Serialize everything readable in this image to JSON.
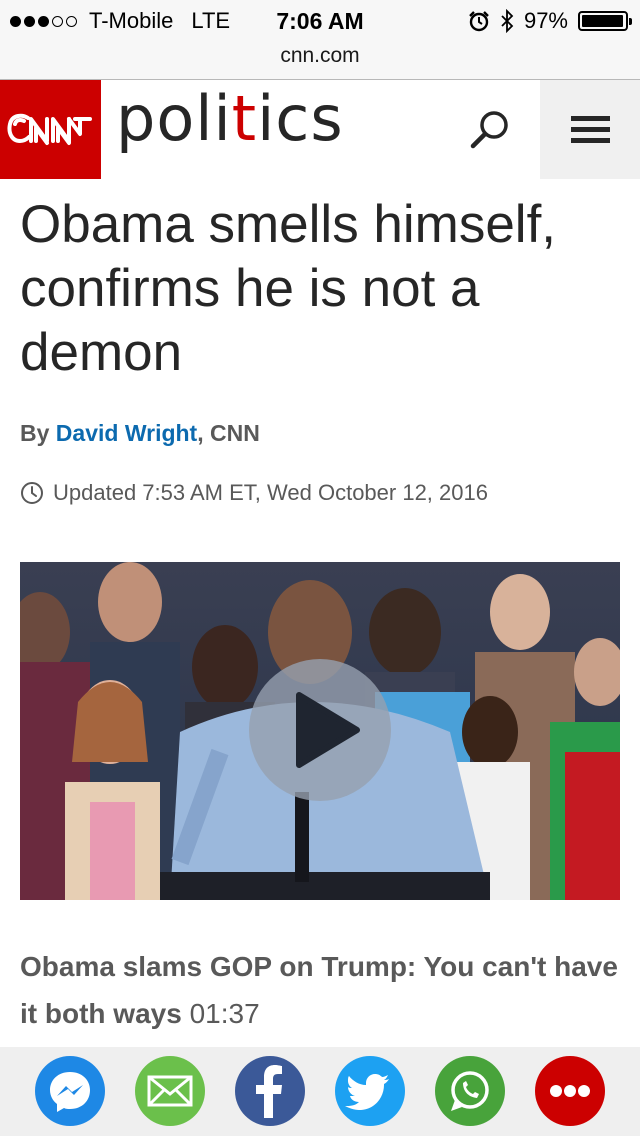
{
  "status_bar": {
    "carrier": "T-Mobile",
    "network": "LTE",
    "time": "7:06 AM",
    "battery": "97%",
    "battery_level": 0.97,
    "signal_bars": 3,
    "signal_total": 5,
    "icons": [
      "alarm-icon",
      "bluetooth-icon",
      "battery-icon"
    ]
  },
  "browser": {
    "url": "cnn.com"
  },
  "header": {
    "logo": "CNN",
    "section_parts": [
      "poli",
      "t",
      "ics"
    ],
    "accent_color": "#cc0000",
    "icons": {
      "search": "search-icon",
      "menu": "hamburger-menu-icon"
    }
  },
  "article": {
    "headline": "Obama smells himself, confirms he is not a demon",
    "byline_prefix": "By",
    "author": "David Wright",
    "byline_suffix": ", CNN",
    "updated": "Updated 7:53 AM ET, Wed October 12, 2016",
    "author_color": "#0c6aaf"
  },
  "video": {
    "caption": "Obama slams GOP on Trump: You can't have it both ways",
    "duration": "01:37",
    "play_icon": "play-icon"
  },
  "share_bar": {
    "buttons": [
      {
        "name": "messenger",
        "icon": "messenger-icon",
        "color": "#1e88e5"
      },
      {
        "name": "email",
        "icon": "mail-icon",
        "color": "#6bc04b"
      },
      {
        "name": "facebook",
        "icon": "facebook-icon",
        "color": "#3b5998"
      },
      {
        "name": "twitter",
        "icon": "twitter-icon",
        "color": "#1da1f2"
      },
      {
        "name": "whatsapp",
        "icon": "whatsapp-icon",
        "color": "#48a33b"
      },
      {
        "name": "more",
        "icon": "more-icon",
        "color": "#cc0000"
      }
    ]
  }
}
